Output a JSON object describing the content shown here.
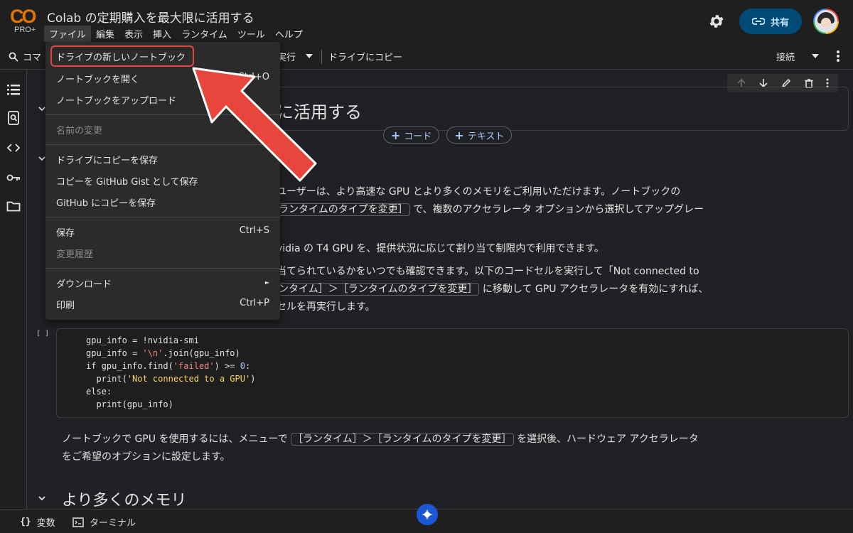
{
  "header": {
    "logo_text": "CO",
    "logo_badge": "PRO+",
    "title": "Colab の定期購入を最大限に活用する",
    "menu": [
      "ファイル",
      "編集",
      "表示",
      "挿入",
      "ランタイム",
      "ツール",
      "ヘルプ"
    ],
    "share_label": "共有"
  },
  "toolbar": {
    "command_label": "コマ",
    "run_label": "実行",
    "copy_to_drive": "ドライブにコピー",
    "connect_label": "接続"
  },
  "file_menu": {
    "items": [
      {
        "label": "ドライブの新しいノートブック",
        "shortcut": ""
      },
      {
        "label": "ノートブックを開く",
        "shortcut": "Ctrl+O"
      },
      {
        "label": "ノートブックをアップロード",
        "shortcut": ""
      },
      {
        "label": "名前の変更",
        "shortcut": ""
      },
      {
        "label": "ドライブにコピーを保存",
        "shortcut": ""
      },
      {
        "label": "コピーを GitHub Gist として保存",
        "shortcut": ""
      },
      {
        "label": "GitHub にコピーを保存",
        "shortcut": ""
      },
      {
        "label": "保存",
        "shortcut": "Ctrl+S"
      },
      {
        "label": "変更履歴",
        "shortcut": ""
      },
      {
        "label": "ダウンロード",
        "shortcut": "►"
      },
      {
        "label": "印刷",
        "shortcut": "Ctrl+P"
      }
    ]
  },
  "notebook": {
    "heading_visible": "に活用する",
    "add_code": "コード",
    "add_text": "テキスト",
    "para1_line1": "ユーザーは、より高速な GPU とより多くのメモリをご利用いただけます。ノートブックの",
    "para1_line2_chip": "ランタイムのタイプを変更］",
    "para1_line2_rest": "で、複数のアクセラレータ オプションから選択してアップグレー",
    "para2": "vidia の T4 GPU を、提供状況に応じて割り当て制限内で利用できます。",
    "para3_line1": "当てられているかをいつでも確認できます。以下のコードセルを実行して「Not connected to",
    "para3_line2_chip": "ンタイム］＞［ランタイムのタイプを変更］",
    "para3_line2_rest": "に移動して GPU アクセラレータを有効にすれば、",
    "para3_line3": "セルを再実行します。",
    "run_marker": "[ ]",
    "code_lines": [
      "gpu_info = !nvidia-smi",
      "gpu_info = '\\n'.join(gpu_info)",
      "if gpu_info.find('failed') >= 0:",
      "  print('Not connected to a GPU')",
      "else:",
      "  print(gpu_info)"
    ],
    "para4_line1_pre": "ノートブックで GPU を使用するには、メニューで",
    "para4_line1_chip": "［ランタイム］＞［ランタイムのタイプを変更］",
    "para4_line1_post": "を選択後、ハードウェア アクセラレータ",
    "para4_line2": "をご希望のオプションに設定します。",
    "section2": "より多くのメモリ"
  },
  "bottombar": {
    "variables": "変数",
    "terminal": "ターミナル"
  },
  "colors": {
    "accent_red": "#e8453c",
    "share_bg": "#004a77",
    "link_blue": "#a8c7fa"
  }
}
